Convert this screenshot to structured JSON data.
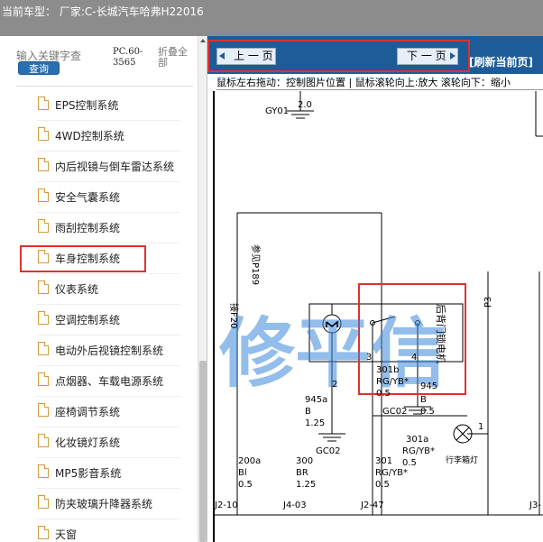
{
  "topbar": {
    "current_model_text": "当前车型：  厂家:C-长城汽车哈弗H22016"
  },
  "sidebar": {
    "search_placeholder": "输入关键字查",
    "search_button": "查询",
    "model_code": "PC.60-3565",
    "collapse_all": "折叠全部",
    "items": [
      {
        "label": "EPS控制系统"
      },
      {
        "label": "4WD控制系统"
      },
      {
        "label": "内后视镜与倒车雷达系统"
      },
      {
        "label": "安全气囊系统"
      },
      {
        "label": "雨刮控制系统"
      },
      {
        "label": "车身控制系统",
        "selected": true
      },
      {
        "label": "仪表系统"
      },
      {
        "label": "空调控制系统"
      },
      {
        "label": "电动外后视镜控制系统"
      },
      {
        "label": "点烟器、车载电源系统"
      },
      {
        "label": "座椅调节系统"
      },
      {
        "label": "化妆镜灯系统"
      },
      {
        "label": "MP5影音系统"
      },
      {
        "label": "防夹玻璃升降器系统"
      },
      {
        "label": "天窗"
      }
    ]
  },
  "viewer": {
    "prev_page": "上 一 页",
    "next_page": "下 一 页",
    "refresh": "[刷新当前页]",
    "hint": "鼠标左右拖动：控制图片位置 | 鼠标滚轮向上:放大  滚轮向下：缩小"
  },
  "diagram": {
    "labels": {
      "gy01": "GY01",
      "gy01_size": "2.0",
      "ref_p189": "参见P189",
      "gf20": "接F20",
      "motor_label": "后背门锁电机",
      "pin2": "2",
      "pin3": "3",
      "pin4": "4",
      "w301b": "301b",
      "rg_yb_1": "RG/YB*",
      "size_05_a": "0.5",
      "w945": "945",
      "w945a": "945a",
      "b_1": "B",
      "size_125_a": "1.25",
      "gc02_a": "GC02",
      "gc02_b": "GC02",
      "b_2": "B",
      "size_05_b": "0.5",
      "w301a": "301a",
      "rg_yb_2": "RG/YB*",
      "size_05_c": "0.5",
      "pin1": "1",
      "trunk_lamp": "行李箱灯",
      "w200a": "200a",
      "bl": "Bl",
      "size_05_d": "0.5",
      "w300": "300",
      "br": "BR",
      "size_125_b": "1.25",
      "w301": "301",
      "rg_yb_3": "RG/YB*",
      "size_05_e": "0.5",
      "p3": "P3",
      "j2_10": "J2-10",
      "j4_03": "J4-03",
      "j2_47": "J2-47",
      "j3": "J3-",
      "watermark": "修平信"
    }
  }
}
